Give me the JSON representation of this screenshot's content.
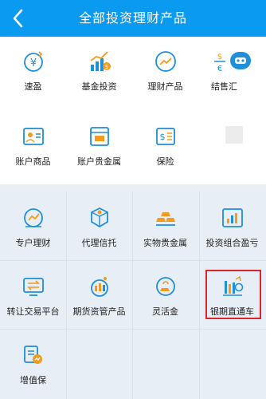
{
  "header": {
    "title": "全部投资理财产品"
  },
  "top_items": [
    {
      "label": "速盈",
      "icon": "yen-coin-icon"
    },
    {
      "label": "基金投资",
      "icon": "fund-chart-icon"
    },
    {
      "label": "理财产品",
      "icon": "trend-circle-icon"
    },
    {
      "label": "结售汇",
      "icon": "currency-exchange-icon"
    },
    {
      "label": "账户商品",
      "icon": "account-goods-icon"
    },
    {
      "label": "账户贵金属",
      "icon": "precious-metal-account-icon"
    },
    {
      "label": "保险",
      "icon": "insurance-icon"
    }
  ],
  "bottom_items": [
    {
      "label": "专户理财",
      "icon": "dedicated-wealth-icon"
    },
    {
      "label": "代理信托",
      "icon": "trust-box-icon"
    },
    {
      "label": "实物贵金属",
      "icon": "gold-bars-icon"
    },
    {
      "label": "投资组合盈亏",
      "icon": "portfolio-chart-icon"
    },
    {
      "label": "转让交易平台",
      "icon": "transfer-platform-icon"
    },
    {
      "label": "期货资管产品",
      "icon": "futures-asset-icon"
    },
    {
      "label": "灵活金",
      "icon": "flexible-gold-icon"
    },
    {
      "label": "银期直通车",
      "icon": "bank-futures-icon"
    },
    {
      "label": "增值保",
      "icon": "value-added-icon"
    }
  ],
  "colors": {
    "header": "#0a9af0",
    "icon_blue": "#1e8fd8",
    "icon_orange": "#f29b1c",
    "highlight": "#d9262b"
  }
}
